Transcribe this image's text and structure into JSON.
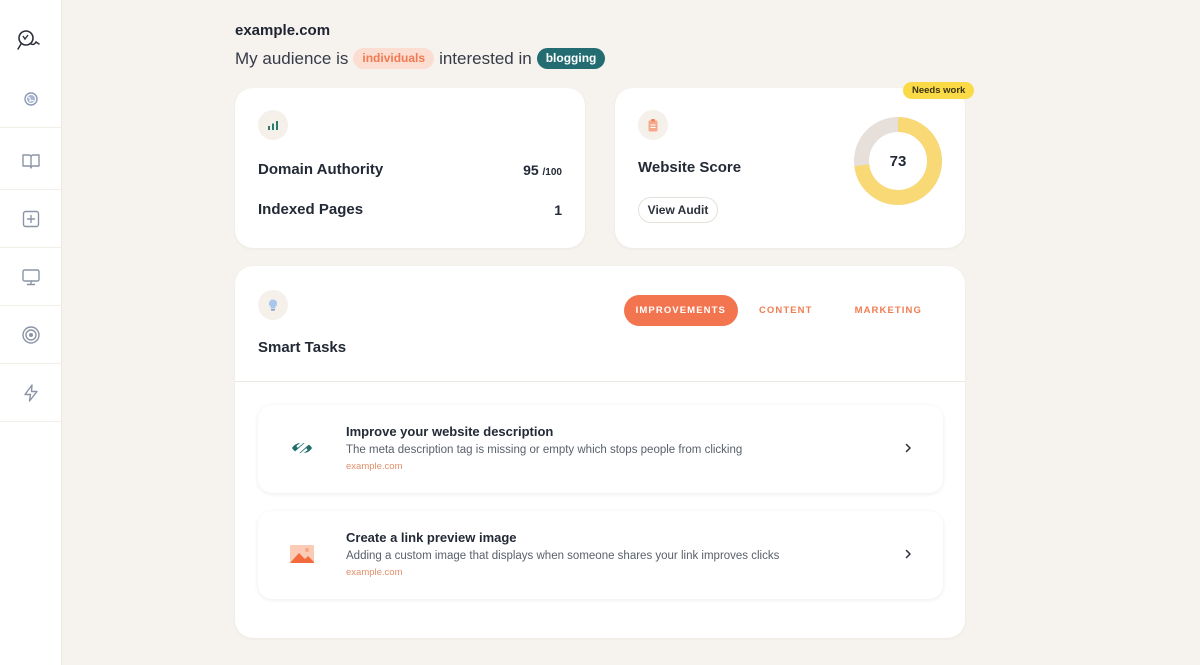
{
  "header": {
    "site": "example.com",
    "audience_prefix": "My audience is",
    "audience_who": "individuals",
    "audience_mid": "interested in",
    "audience_topic": "blogging"
  },
  "sidebar": {
    "items": [
      {
        "icon": "logo-icon"
      },
      {
        "icon": "globe-icon"
      },
      {
        "icon": "book-icon"
      },
      {
        "icon": "plus-square-icon"
      },
      {
        "icon": "monitor-icon"
      },
      {
        "icon": "target-icon"
      },
      {
        "icon": "lightning-icon"
      }
    ]
  },
  "domain_card": {
    "authority_label": "Domain Authority",
    "authority_value": "95",
    "authority_max": "/100",
    "pages_label": "Indexed Pages",
    "pages_value": "1"
  },
  "score_card": {
    "badge": "Needs work",
    "title": "Website Score",
    "button": "View Audit",
    "score": "73",
    "score_fraction": 0.73,
    "colors": {
      "fill": "#f9d976",
      "track": "#e6dfda"
    }
  },
  "tasks_card": {
    "title": "Smart Tasks",
    "tabs": [
      {
        "label": "IMPROVEMENTS",
        "active": true
      },
      {
        "label": "CONTENT",
        "active": false
      },
      {
        "label": "MARKETING",
        "active": false
      }
    ],
    "items": [
      {
        "title": "Improve your website description",
        "desc": "The meta description tag is missing or empty which stops people from clicking",
        "site": "example.com",
        "icon": "no-view-icon"
      },
      {
        "title": "Create a link preview image",
        "desc": "Adding a custom image that displays when someone shares your link improves clicks",
        "site": "example.com",
        "icon": "image-icon"
      }
    ]
  },
  "colors": {
    "accent": "#f37550",
    "teal": "#236d72",
    "background": "#f6f3ee"
  }
}
